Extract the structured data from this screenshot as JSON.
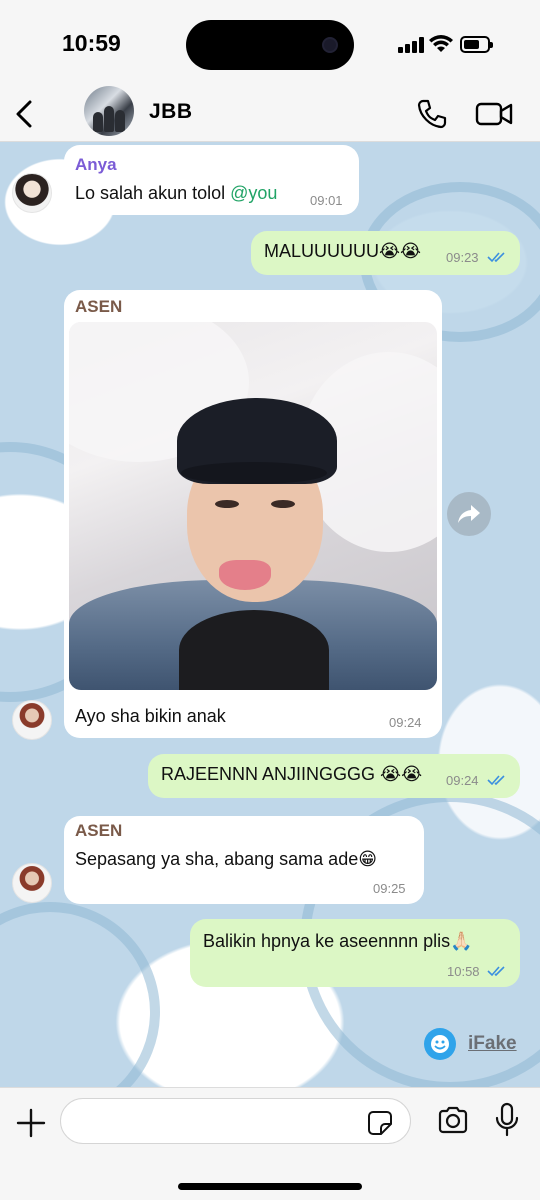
{
  "status_bar": {
    "time": "10:59",
    "battery_level": 0.7
  },
  "header": {
    "chat_name": "JBB",
    "icons": {
      "back": "chevron-left-icon",
      "call": "phone-icon",
      "video": "video-camera-icon"
    }
  },
  "messages": [
    {
      "direction": "in",
      "sender": "Anya",
      "sender_color": "#7b5cd6",
      "text": "Lo salah akun tolol ",
      "mention": "@you",
      "time": "09:01"
    },
    {
      "direction": "out",
      "text": "MALUUUUUU😭😭",
      "time": "09:23",
      "status": "read"
    },
    {
      "direction": "in",
      "sender": "ASEN",
      "sender_color": "#7a5a49",
      "has_photo": true,
      "text": "Ayo sha bikin anak",
      "time": "09:24"
    },
    {
      "direction": "out",
      "text": "RAJEENNN ANJIINGGGG 😭😭",
      "time": "09:24",
      "status": "read"
    },
    {
      "direction": "in",
      "sender": "ASEN",
      "sender_color": "#7a5a49",
      "text": "Sepasang ya sha, abang sama ade😁",
      "time": "09:25"
    },
    {
      "direction": "out",
      "text": "Balikin hpnya ke aseennnn plis🙏🏻",
      "time": "10:58",
      "status": "read"
    }
  ],
  "watermark": {
    "label": "iFake",
    "icon": "smiley-icon"
  },
  "composer": {
    "placeholder": "",
    "icons": {
      "attach": "plus-icon",
      "sticker": "sticker-icon",
      "camera": "camera-icon",
      "mic": "microphone-icon"
    }
  },
  "colors": {
    "incoming_bubble": "#ffffff",
    "outgoing_bubble": "#dcf7c5",
    "read_ticks": "#3b8fe0",
    "wallpaper": "#bfd7e9"
  }
}
